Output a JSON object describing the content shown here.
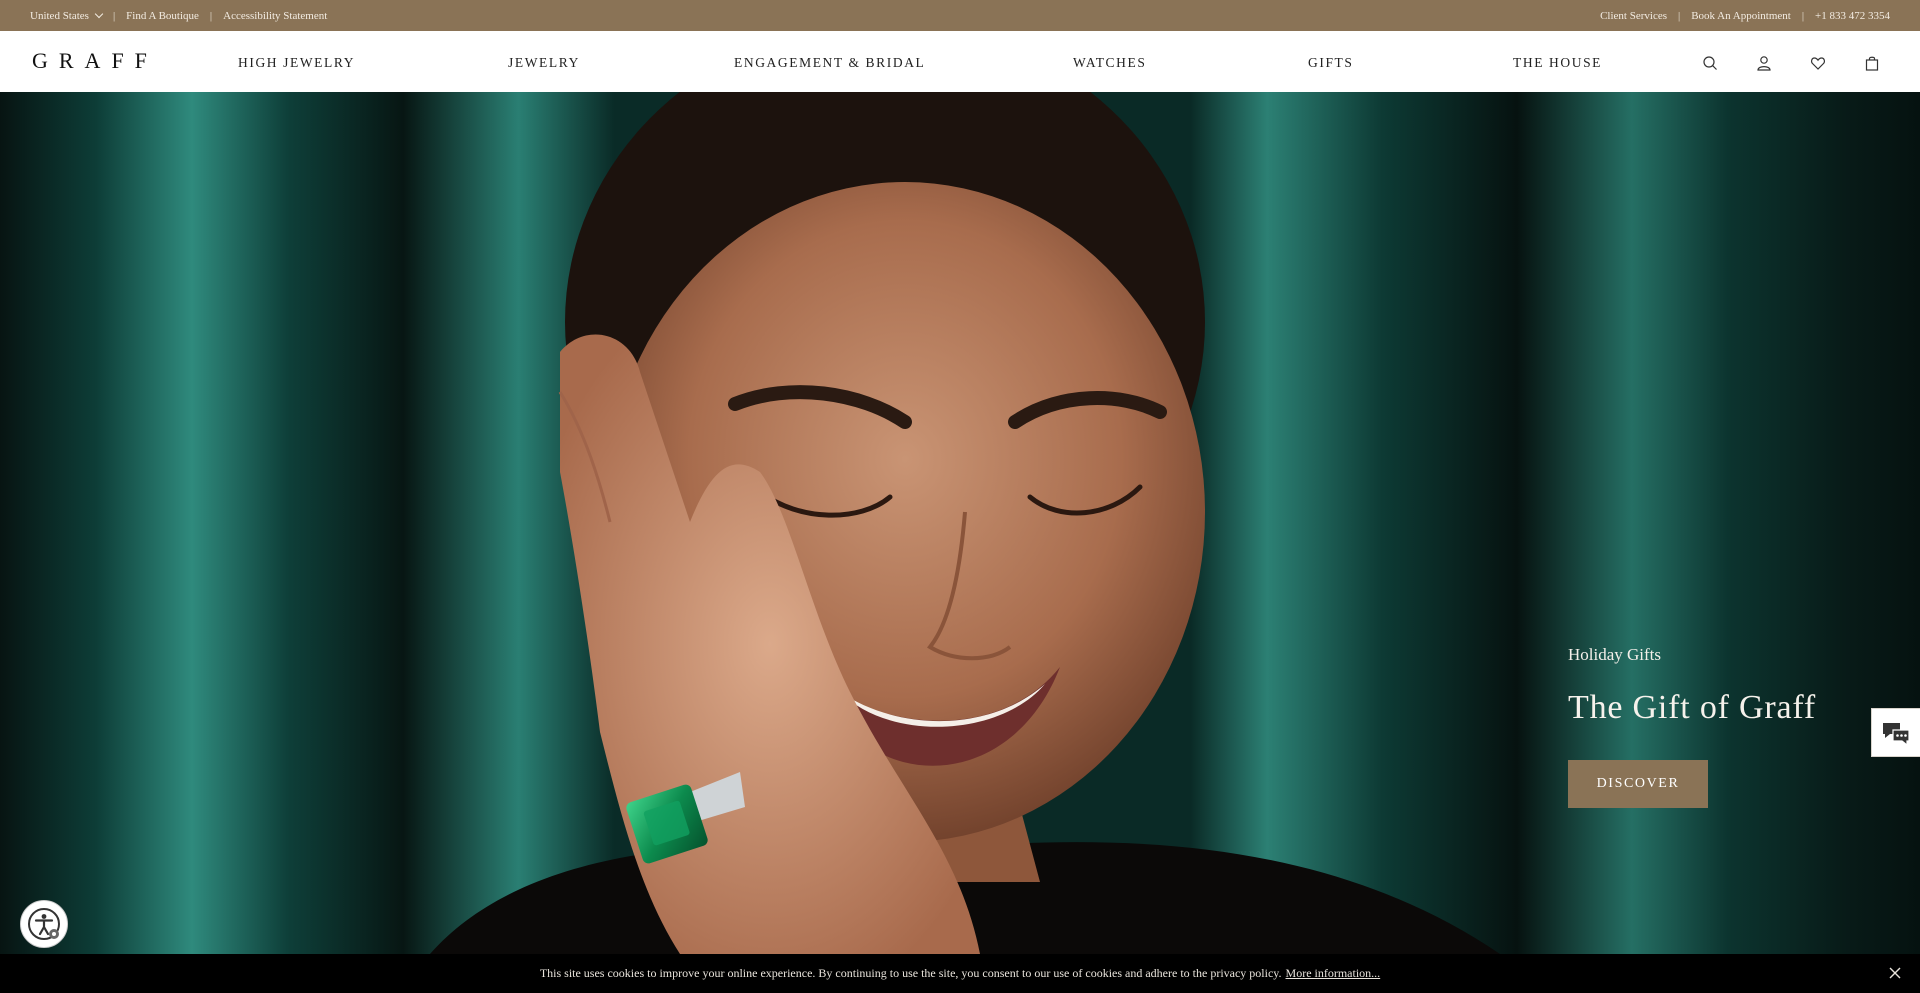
{
  "utility_bar": {
    "country": "United States",
    "find_boutique": "Find A Boutique",
    "accessibility": "Accessibility Statement",
    "client_services": "Client Services",
    "book_appointment": "Book An Appointment",
    "phone": "+1 833 472 3354",
    "separator": "|"
  },
  "nav": {
    "logo": "GRAFF",
    "items": [
      "HIGH JEWELRY",
      "JEWELRY",
      "ENGAGEMENT & BRIDAL",
      "WATCHES",
      "GIFTS",
      "THE HOUSE"
    ],
    "icons": [
      "search-icon",
      "account-icon",
      "heart-icon",
      "bag-icon"
    ]
  },
  "hero": {
    "eyebrow": "Holiday Gifts",
    "title": "The Gift of Graff",
    "button": "DISCOVER"
  },
  "cookie": {
    "text": "This site uses cookies to improve your online experience. By continuing to use the site, you consent to our use of cookies and adhere to the privacy policy.",
    "link": "More information..."
  },
  "colors": {
    "brand": "#8a7356",
    "hero_background": "#0f4a44",
    "cookie_bar": "#000000"
  }
}
